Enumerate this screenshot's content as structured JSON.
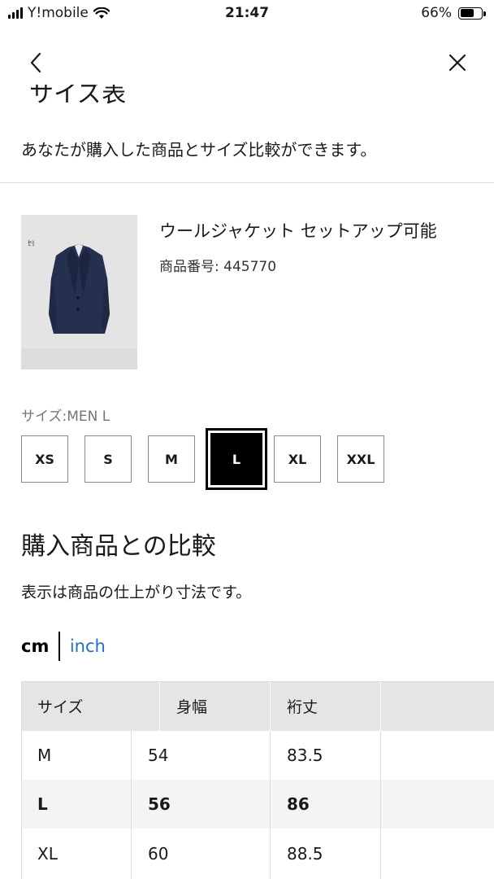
{
  "status_bar": {
    "carrier": "Y!mobile",
    "time": "21:47",
    "battery_percent": "66%",
    "battery_level": 0.66
  },
  "nav": {
    "back_icon": "chevron-left-icon",
    "close_icon": "close-icon"
  },
  "header": {
    "clipped_title": "サイズ表",
    "subtitle": "あなたが購入した商品とサイズ比較ができます。"
  },
  "product": {
    "name": "ウールジャケット セットアップ可能",
    "code": "商品番号: 445770",
    "image_mark": "ｾﾘ"
  },
  "size_selector": {
    "label": "サイズ:MEN L",
    "options": [
      "XS",
      "S",
      "M",
      "L",
      "XL",
      "XXL"
    ],
    "selected": "L"
  },
  "comparison": {
    "title": "購入商品との比較",
    "note": "表示は商品の仕上がり寸法です。",
    "units": {
      "cm": "cm",
      "inch": "inch",
      "active": "cm"
    },
    "table": {
      "headers": [
        "サイズ",
        "身幅",
        "裄丈",
        ""
      ],
      "rows": [
        [
          "M",
          "54",
          "83.5",
          ""
        ],
        [
          "L",
          "56",
          "86",
          ""
        ],
        [
          "XL",
          "60",
          "88.5",
          ""
        ]
      ],
      "highlighted_row": "L"
    }
  },
  "colors": {
    "link": "#1f6fc7",
    "selected_bg": "#000000",
    "header_bg": "#e5e5e5",
    "highlight_row_bg": "#f4f4f4"
  }
}
